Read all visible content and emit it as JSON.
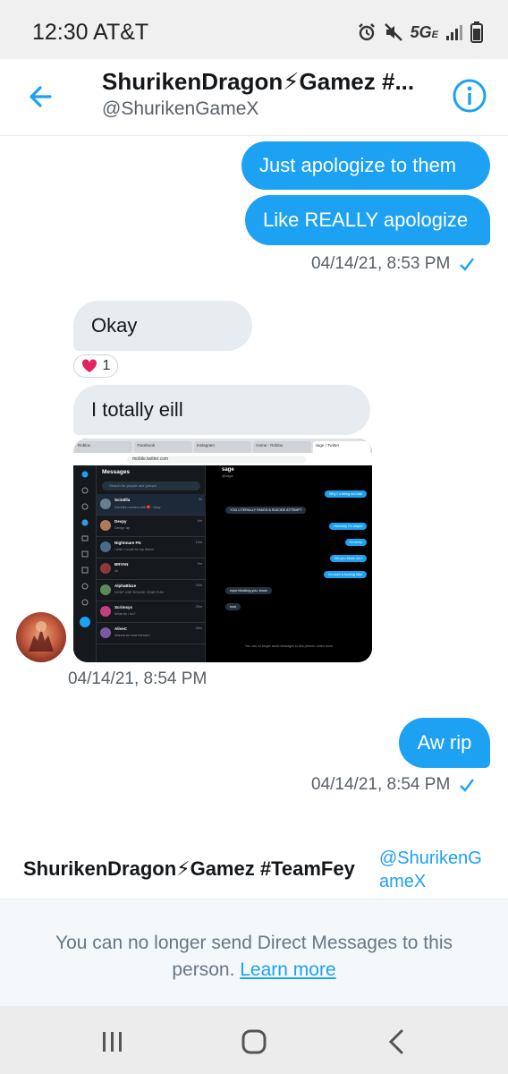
{
  "status_bar": {
    "time": "12:30",
    "carrier": "AT&T",
    "network": "5G",
    "network_sub": "E"
  },
  "header": {
    "name": "ShurikenDragon⚡Gamez #...",
    "handle": "@ShurikenGameX"
  },
  "messages": {
    "out1": "Just apologize to them",
    "out2": "Like REALLY apologize",
    "ts1": "04/14/21, 8:53 PM",
    "in1": "Okay",
    "reaction_count": "1",
    "in2": "I totally eill",
    "ts2": "04/14/21, 8:54 PM",
    "out3": "Aw rip",
    "ts3": "04/14/21, 8:54 PM"
  },
  "screenshot": {
    "tabs": [
      "Roblox",
      "Facebook",
      "Instagram",
      "Home - Roblox",
      "sage / Twitter"
    ],
    "url": "mobile.twitter.com",
    "panel_title": "Messages",
    "search_placeholder": "Search for people and groups",
    "conversations": [
      {
        "name": "ScintIlla",
        "preview": "ScintIlla reacted with ❤️: Okay",
        "time": "2s"
      },
      {
        "name": "Devpy",
        "preview": "Devpy: ay",
        "time": "6m"
      },
      {
        "name": "Nightmare FN",
        "preview": "i wish i could be my friend",
        "time": "10m"
      },
      {
        "name": "BRYAN",
        "preview": "ok",
        "time": "9m"
      },
      {
        "name": "AlphaBlaze",
        "preview": "DONT USE ROUND YEAR FUN",
        "time": "20m"
      },
      {
        "name": "Scrimsyx",
        "preview": "What do i do?",
        "time": "25m"
      },
      {
        "name": "AliveC",
        "preview": "Wanna be best friends?",
        "time": "26m"
      }
    ],
    "chat_name": "sage",
    "chat_handle": "@sage",
    "chat_messages": [
      {
        "side": "out",
        "text": "Why r u being so rude"
      },
      {
        "side": "in",
        "text": "YOU LITERALLY FAKED A SUICIDE ATTEMPT"
      },
      {
        "side": "out",
        "text": "Honestly i'm stupid"
      },
      {
        "side": "out",
        "text": "I'm sorry"
      },
      {
        "side": "out",
        "text": "Did you block me?"
      },
      {
        "side": "out",
        "text": "I'm such a fucking idiot"
      },
      {
        "side": "in",
        "text": "nope blocking you. know"
      },
      {
        "side": "in",
        "text": "now"
      }
    ],
    "chat_footer": "You can no longer send messages to this person. Learn more"
  },
  "footer": {
    "name": "ShurikenDragon⚡Gamez #TeamFey",
    "handle_line1": "@ShurikenG",
    "handle_line2": "ameX",
    "notice_line1": "You can no longer send Direct Messages to this",
    "notice_line2": "person.",
    "learn_more": "Learn more"
  },
  "colors": {
    "accent": "#1da1f2",
    "incoming_bubble": "#e6ecf0",
    "heart": "#e0245e"
  },
  "icons": [
    "back-arrow-icon",
    "info-icon",
    "heart-icon",
    "check-icon",
    "alarm-icon",
    "mute-icon",
    "signal-icon",
    "battery-icon",
    "recents-icon",
    "home-icon",
    "back-nav-icon"
  ]
}
